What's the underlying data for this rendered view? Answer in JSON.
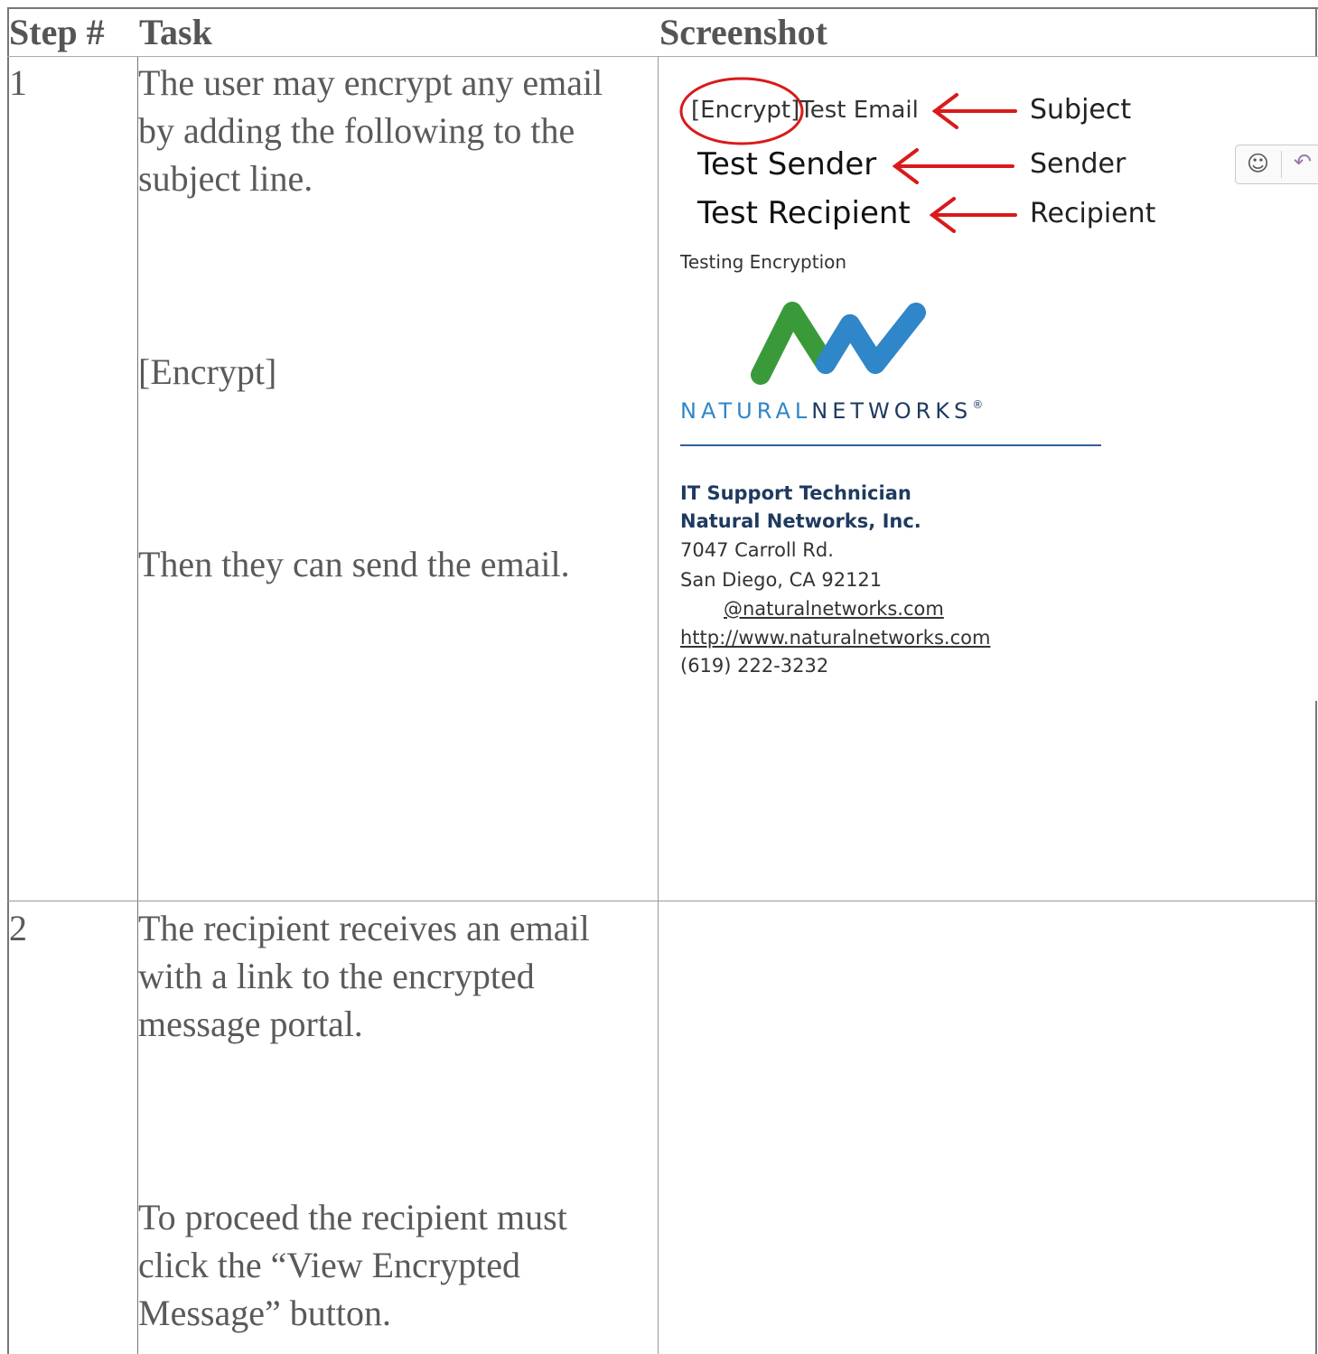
{
  "table": {
    "headers": [
      "Step #",
      "Task",
      "Screenshot"
    ],
    "rows": [
      {
        "step": "1",
        "task_paragraphs": [
          "The user may encrypt any email by adding the following to the subject line.",
          "[Encrypt]",
          "Then they can send the email."
        ]
      },
      {
        "step": "2",
        "task_paragraphs": [
          "The recipient receives an email with a link to the encrypted message portal.",
          "To proceed the recipient must click the “View Encrypted Message” button."
        ]
      }
    ]
  },
  "screenshot": {
    "subject_tag": "[Encrypt]",
    "subject_rest": "Test Email",
    "sender": "Test Sender",
    "recipient": "Test Recipient",
    "labels": {
      "subject": "Subject",
      "sender": "Sender",
      "recipient": "Recipient"
    },
    "body": "Testing Encryption",
    "logo_text": {
      "natural": "NATURAL",
      "networks": "NETWORKS",
      "mark": "®"
    },
    "signature": {
      "title": "IT Support Technician",
      "company": "Natural Networks, Inc.",
      "address1": "7047 Carroll Rd.",
      "address2": "San Diego, CA 92121",
      "email": "@naturalnetworks.com",
      "website": "http://www.naturalnetworks.com",
      "phone": "(619) 222-3232"
    },
    "toolbar_icons": [
      "smiley-icon",
      "reply-icon"
    ],
    "annotation_color": "#d91a1a",
    "logo_colors": {
      "green": "#3a9a3a",
      "blue": "#2f86c9",
      "navy": "#1e3a5f"
    }
  }
}
